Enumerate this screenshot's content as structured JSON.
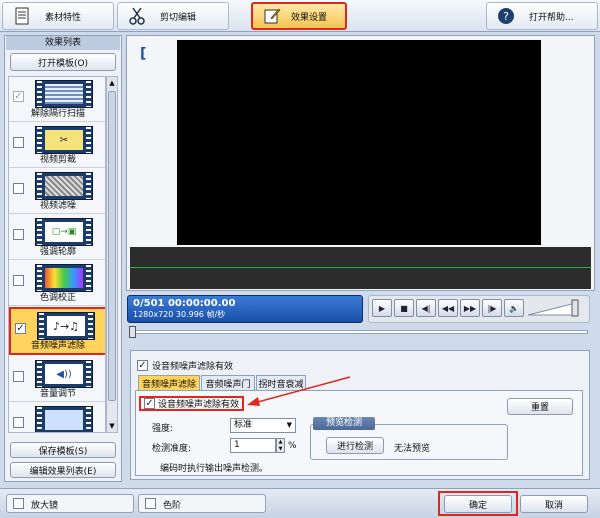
{
  "tabs": [
    {
      "label": "素材特性",
      "icon": "document-icon",
      "selected": false
    },
    {
      "label": "剪切编辑",
      "icon": "scissors-icon",
      "selected": false
    },
    {
      "label": "效果设置",
      "icon": "effect-settings-icon",
      "selected": true
    },
    {
      "label": "打开帮助...",
      "icon": "help-icon",
      "selected": false
    }
  ],
  "sidebar": {
    "title": "效果列表",
    "open_template": "打开模板(O)",
    "save_template": "保存模板(S)",
    "edit_effect_list": "编辑效果列表(E)",
    "items": [
      {
        "label": "解除隔行扫描",
        "checked": true,
        "disabled": true,
        "icon": "deinterlace-icon"
      },
      {
        "label": "视频剪裁",
        "checked": false,
        "icon": "video-crop-icon"
      },
      {
        "label": "视频滤噪",
        "checked": false,
        "icon": "video-denoise-icon"
      },
      {
        "label": "强调轮廓",
        "checked": false,
        "icon": "edge-enhance-icon"
      },
      {
        "label": "色调校正",
        "checked": false,
        "icon": "color-correction-icon"
      },
      {
        "label": "音频噪声滤除",
        "checked": true,
        "selected": true,
        "icon": "audio-noise-filter-icon"
      },
      {
        "label": "音量调节",
        "checked": false,
        "icon": "volume-adjust-icon"
      },
      {
        "label": "",
        "checked": false,
        "icon": "more-effect-icon"
      }
    ]
  },
  "preview": {
    "bracket": "[",
    "timecode": "0/501  00:00:00.00",
    "resolution": "1280x720 30.996 帧/秒"
  },
  "controls": [
    "play-icon",
    "stop-icon",
    "prev-frame-icon",
    "rewind-icon",
    "fast-forward-icon",
    "next-frame-icon",
    "speaker-icon"
  ],
  "settings": {
    "enable_top_label": "设音频噪声滤除有效",
    "enable_top_checked": true,
    "subtabs": [
      "音频噪声滤除",
      "音频噪声门",
      "拐时音衰减"
    ],
    "enable_label": "设音频噪声滤除有效",
    "enable_checked": true,
    "reset_label": "重置",
    "strength_label": "强度:",
    "strength_value": "标准",
    "accuracy_label": "检测准度:",
    "accuracy_value": "1",
    "accuracy_unit": "%",
    "preview_group_title": "预览检测",
    "run_detect_label": "进行检测",
    "no_preview_label": "无法预览",
    "note": "编码时执行输出噪声检测。"
  },
  "footer": {
    "magnifier_label": "放大镜",
    "magnifier_checked": false,
    "color_levels_label": "色阶",
    "color_levels_checked": false,
    "ok_label": "确定",
    "cancel_label": "取消"
  },
  "colors": {
    "highlight_red": "#e0261d",
    "selected_yellow": "#ffd35c",
    "timecode_bg": "#1f5fbf"
  }
}
